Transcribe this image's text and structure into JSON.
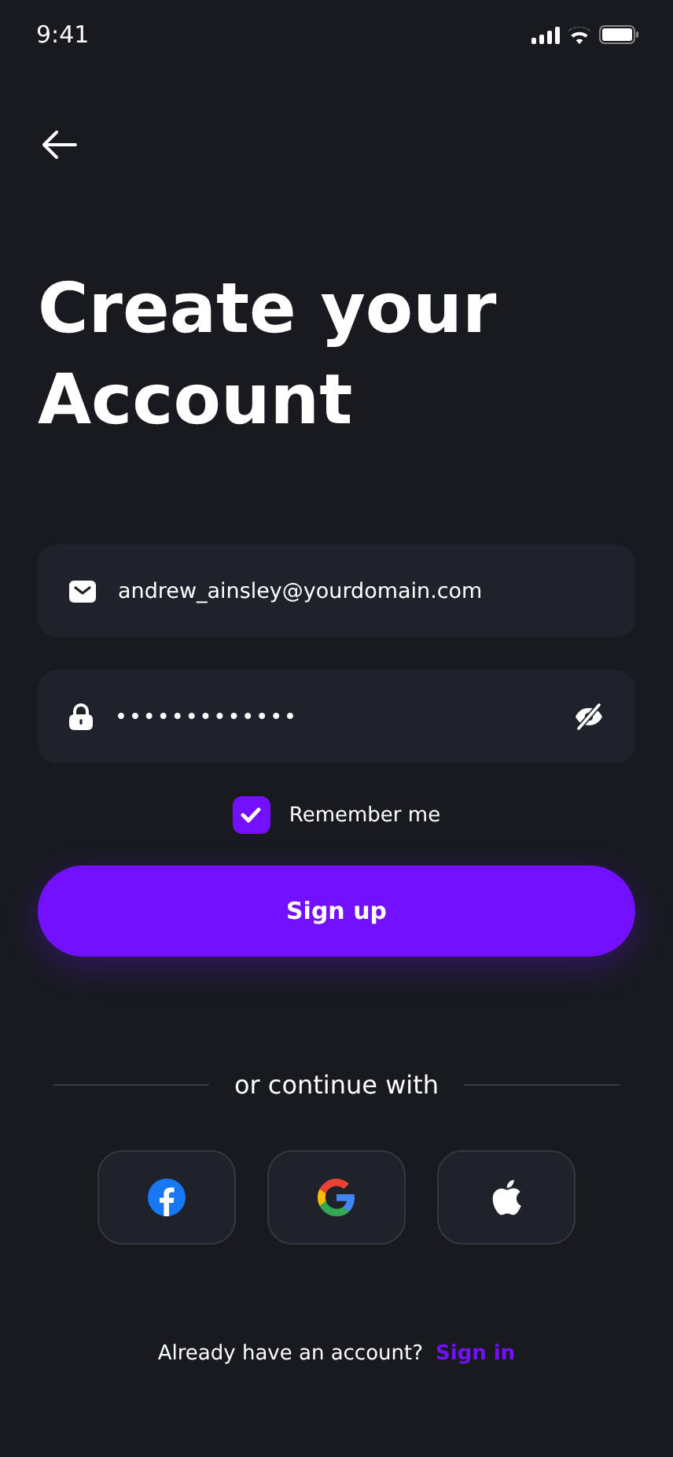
{
  "status_bar": {
    "time": "9:41"
  },
  "title": "Create your Account",
  "email_field": {
    "value": "andrew_ainsley@yourdomain.com"
  },
  "password_field": {
    "value": "•••••••••••••"
  },
  "remember": {
    "label": "Remember me",
    "checked": true
  },
  "primary_button": {
    "label": "Sign up"
  },
  "divider_text": "or continue with",
  "social_buttons": [
    {
      "kind": "facebook"
    },
    {
      "kind": "google"
    },
    {
      "kind": "apple"
    }
  ],
  "footer": {
    "text": "Already have an account?",
    "link": "Sign in"
  }
}
